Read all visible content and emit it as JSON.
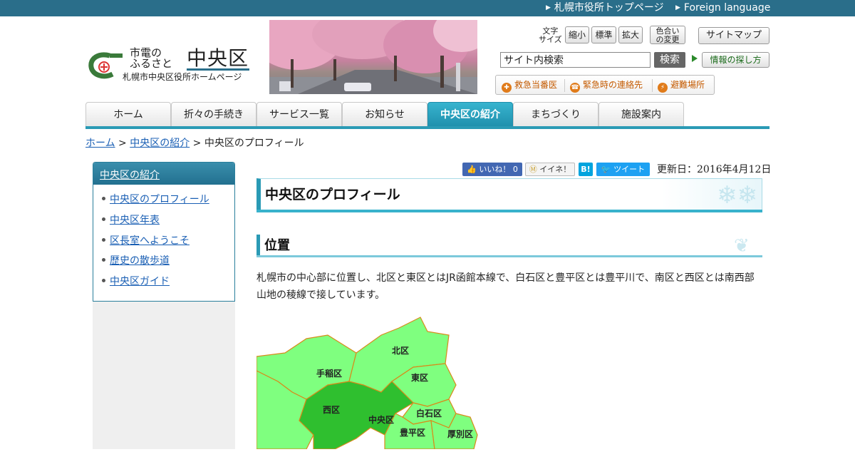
{
  "topbar": {
    "city_top": "札幌市役所トップページ",
    "foreign": "Foreign language"
  },
  "logo": {
    "line1": "市電の",
    "line2": "ふるさと",
    "big": "中央区",
    "sub": "札幌市中央区役所ホームページ"
  },
  "tools": {
    "font_size_label_1": "文字",
    "font_size_label_2": "サイズ",
    "small": "縮小",
    "standard": "標準",
    "large": "拡大",
    "color_1": "色合い",
    "color_2": "の変更",
    "sitemap": "サイトマップ",
    "search_value": "サイト内検索",
    "search_button": "検索",
    "howto": "情報の探し方"
  },
  "emergency": {
    "doctor": "救急当番医",
    "contact": "緊急時の連絡先",
    "shelter": "避難場所"
  },
  "nav": {
    "tabs": [
      "ホーム",
      "折々の手続き",
      "サービス一覧",
      "お知らせ",
      "中央区の紹介",
      "まちづくり",
      "施設案内"
    ],
    "active_index": 4
  },
  "breadcrumb": {
    "home": "ホーム",
    "sep1": " > ",
    "section": "中央区の紹介",
    "sep2": " > ",
    "current": "中央区のプロフィール"
  },
  "sidebar": {
    "heading": "中央区の紹介",
    "items": [
      "中央区のプロフィール",
      "中央区年表",
      "区長室へようこそ",
      "歴史の散歩道",
      "中央区ガイド"
    ]
  },
  "social": {
    "fb": "いいね！ 0",
    "mixi": "イイネ！",
    "hatena": "B!",
    "tweet": "ツイート"
  },
  "updated": "更新日：2016年4月12日",
  "page_title": "中央区のプロフィール",
  "section_heading": "位置",
  "body": "札幌市の中心部に位置し、北区と東区とはJR函館本線で、白石区と豊平区とは豊平川で、南区と西区とは南西部山地の稜線で接しています。",
  "map": {
    "labels": [
      "北区",
      "東区",
      "手稲区",
      "西区",
      "中央区",
      "白石区",
      "豊平区",
      "厚別区"
    ],
    "colors": {
      "district": "#7fff7f",
      "highlight": "#2fbf2f",
      "border": "#d88a1a"
    }
  },
  "colors": {
    "accent": "#2a9ab5",
    "topbar": "#2a6e8a",
    "link": "#1a5fb4"
  }
}
